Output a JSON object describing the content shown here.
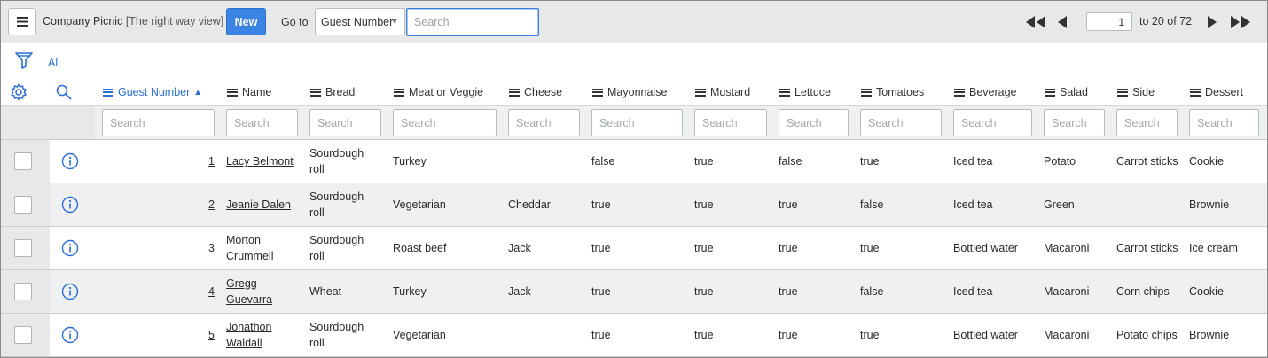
{
  "header": {
    "list_title": "Company Picnic",
    "view_label": "[The right way view]",
    "new_label": "New",
    "goto_label": "Go to",
    "goto_field": "Guest Number",
    "search_placeholder": "Search"
  },
  "pagination": {
    "current_page": "1",
    "range_text": "to 20 of 72"
  },
  "filter": {
    "all_label": "All"
  },
  "columns": [
    {
      "label": "Guest Number",
      "sorted": "ascending"
    },
    {
      "label": "Name"
    },
    {
      "label": "Bread"
    },
    {
      "label": "Meat or Veggie"
    },
    {
      "label": "Cheese"
    },
    {
      "label": "Mayonnaise"
    },
    {
      "label": "Mustard"
    },
    {
      "label": "Lettuce"
    },
    {
      "label": "Tomatoes"
    },
    {
      "label": "Beverage"
    },
    {
      "label": "Salad"
    },
    {
      "label": "Side"
    },
    {
      "label": "Dessert"
    }
  ],
  "column_search_placeholder": "Search",
  "rows": [
    {
      "guest_number": "1",
      "name": "Lacy Belmont",
      "bread": "Sourdough roll",
      "meat": "Turkey",
      "cheese": "",
      "mayonnaise": "false",
      "mustard": "true",
      "lettuce": "false",
      "tomatoes": "true",
      "beverage": "Iced tea",
      "salad": "Potato",
      "side": "Carrot sticks",
      "dessert": "Cookie"
    },
    {
      "guest_number": "2",
      "name": "Jeanie Dalen",
      "bread": "Sourdough roll",
      "meat": "Vegetarian",
      "cheese": "Cheddar",
      "mayonnaise": "true",
      "mustard": "true",
      "lettuce": "true",
      "tomatoes": "false",
      "beverage": "Iced tea",
      "salad": "Green",
      "side": "",
      "dessert": "Brownie"
    },
    {
      "guest_number": "3",
      "name": "Morton Crummell",
      "bread": "Sourdough roll",
      "meat": "Roast beef",
      "cheese": "Jack",
      "mayonnaise": "true",
      "mustard": "true",
      "lettuce": "true",
      "tomatoes": "true",
      "beverage": "Bottled water",
      "salad": "Macaroni",
      "side": "Carrot sticks",
      "dessert": "Ice cream"
    },
    {
      "guest_number": "4",
      "name": "Gregg Guevarra",
      "bread": "Wheat",
      "meat": "Turkey",
      "cheese": "Jack",
      "mayonnaise": "true",
      "mustard": "true",
      "lettuce": "true",
      "tomatoes": "false",
      "beverage": "Iced tea",
      "salad": "Macaroni",
      "side": "Corn chips",
      "dessert": "Cookie"
    },
    {
      "guest_number": "5",
      "name": "Jonathon Waldall",
      "bread": "Sourdough roll",
      "meat": "Vegetarian",
      "cheese": "",
      "mayonnaise": "true",
      "mustard": "true",
      "lettuce": "true",
      "tomatoes": "true",
      "beverage": "Bottled water",
      "salad": "Macaroni",
      "side": "Potato chips",
      "dessert": "Brownie"
    }
  ],
  "icons": {
    "menu": "hamburger-menu-icon",
    "filter": "funnel-icon",
    "settings": "gear-icon",
    "search": "magnifier-icon",
    "info": "info-circle-icon",
    "first": "first-page-icon",
    "prev": "previous-page-icon",
    "next": "next-page-icon",
    "last": "last-page-icon"
  },
  "colors": {
    "accent": "#3b84e4",
    "link": "#2b6fd6",
    "header_bg": "#e6e8ea",
    "alt_row_bg": "#eef0f1"
  }
}
